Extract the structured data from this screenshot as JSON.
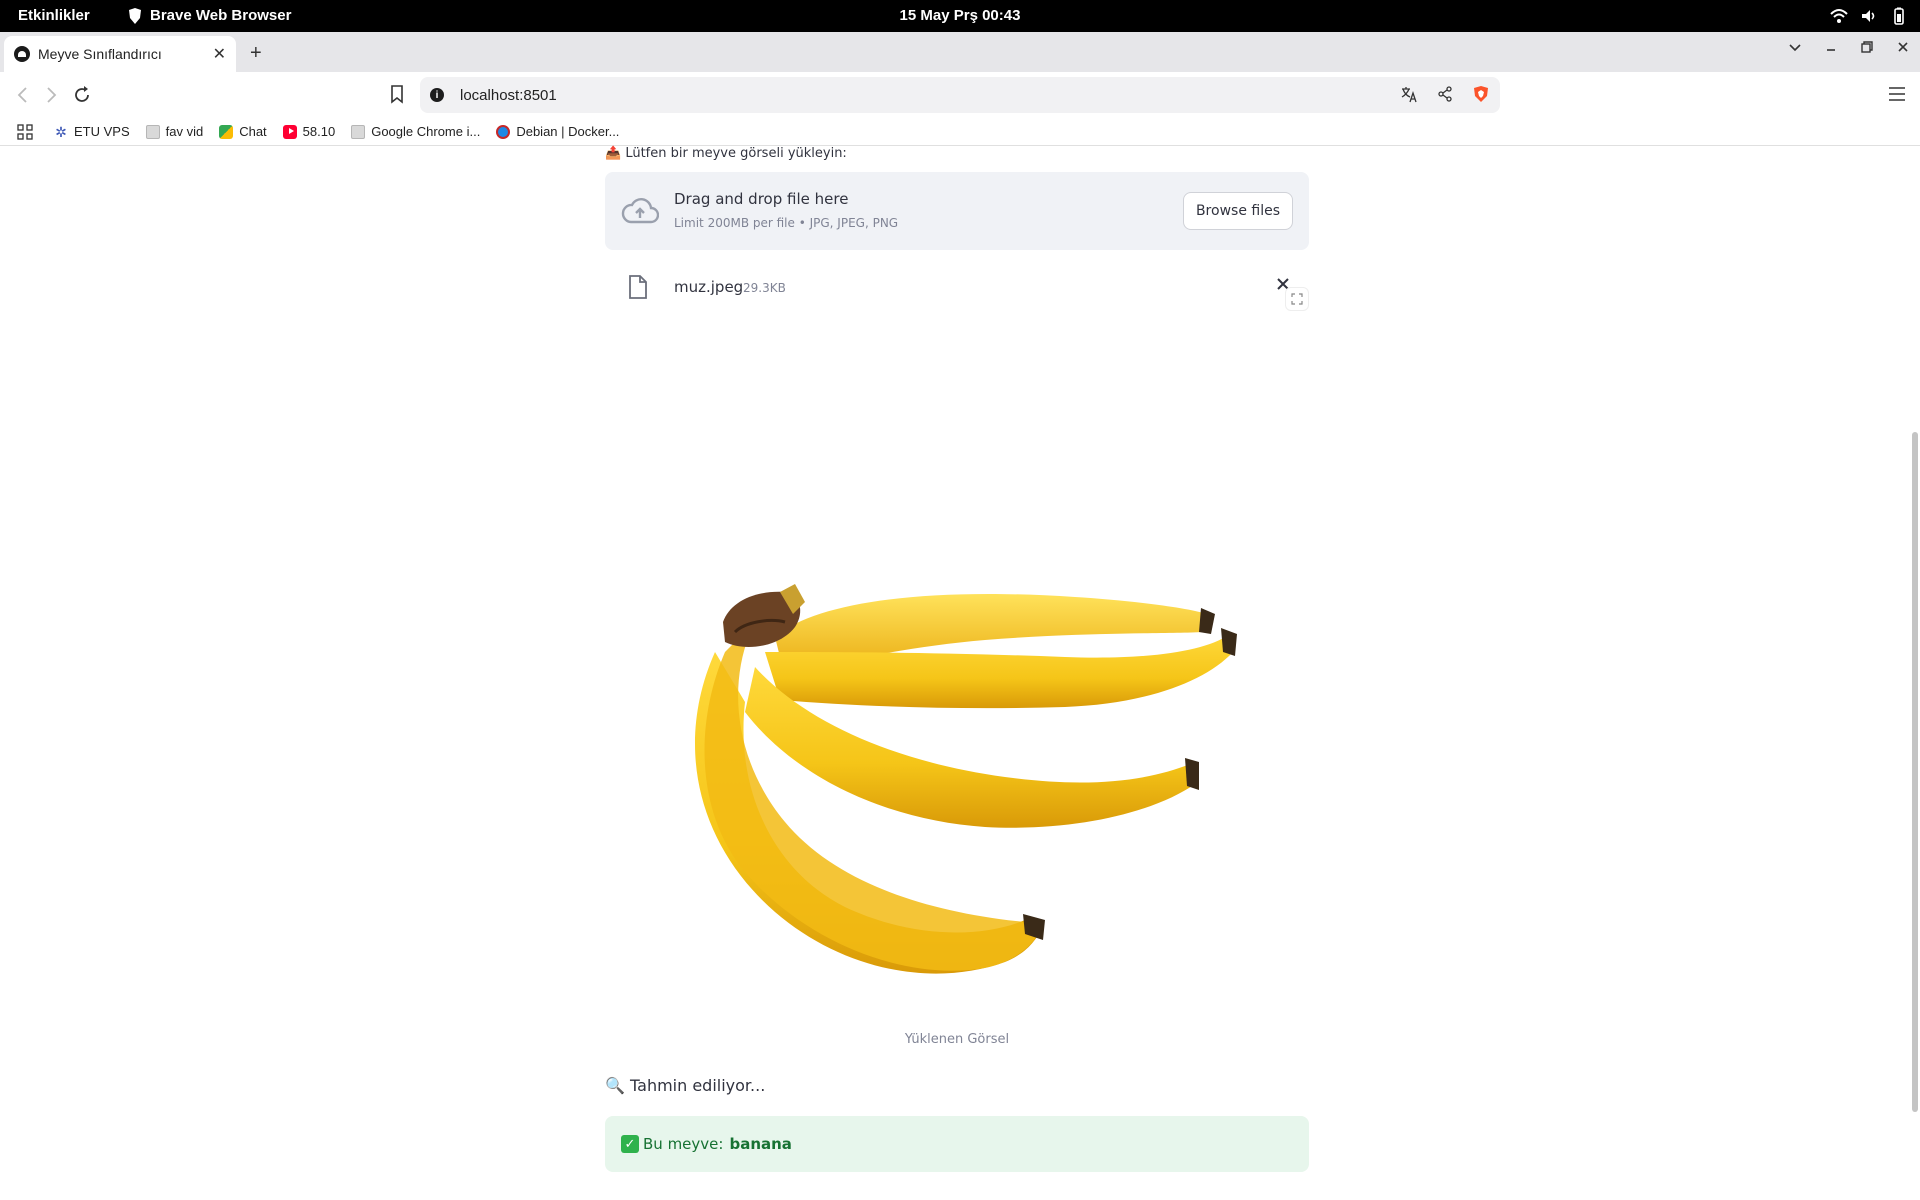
{
  "system_bar": {
    "activities": "Etkinlikler",
    "app_name": "Brave Web Browser",
    "clock": "15 May Prş  00:43"
  },
  "browser": {
    "tab_title": "Meyve Sınıflandırıcı",
    "url": "localhost:8501",
    "bookmarks": [
      {
        "label": "ETU VPS",
        "icon": "etu-icon"
      },
      {
        "label": "fav vid",
        "icon": "folder-icon"
      },
      {
        "label": "Chat",
        "icon": "chat-icon"
      },
      {
        "label": "58.10",
        "icon": "youtube-icon"
      },
      {
        "label": "Google Chrome i...",
        "icon": "folder-icon"
      },
      {
        "label": "Debian | Docker...",
        "icon": "debian-icon"
      }
    ]
  },
  "uploader": {
    "label": "📤 Lütfen bir meyve görseli yükleyin:",
    "drop_title": "Drag and drop file here",
    "drop_limit": "Limit 200MB per file • JPG, JPEG, PNG",
    "browse_label": "Browse files",
    "file_name": "muz.jpeg",
    "file_size": "29.3KB"
  },
  "image": {
    "caption": "Yüklenen Görsel",
    "subject": "banana bunch"
  },
  "prediction": {
    "status": "🔍 Tahmin ediliyor...",
    "result_prefix": "Bu meyve:",
    "result_value": "banana",
    "check_glyph": "✓"
  },
  "colors": {
    "success_bg": "#e7f6ec",
    "success_text": "#177233",
    "dropzone_bg": "#f0f2f6",
    "banana_yellow": "#f5c518"
  }
}
